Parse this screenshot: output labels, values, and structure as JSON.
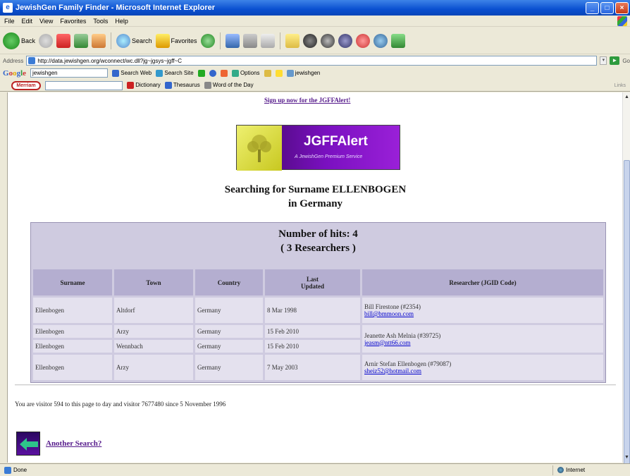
{
  "window": {
    "title": "JewishGen Family Finder - Microsoft Internet Explorer",
    "minimize": "_",
    "maximize": "□",
    "close": "×"
  },
  "menu": [
    "File",
    "Edit",
    "View",
    "Favorites",
    "Tools",
    "Help"
  ],
  "toolbar": {
    "back_label": "Back",
    "search_label": "Search",
    "favorites_label": "Favorites"
  },
  "address": {
    "label": "Address",
    "url": "http://data.jewishgen.org/wconnect/wc.dll?jg~jgsys~jgff~C",
    "go_label": "Go"
  },
  "google_toolbar": {
    "logo": [
      "G",
      "o",
      "o",
      "g",
      "l",
      "e"
    ],
    "query": "jewishgen",
    "search_web": "Search Web",
    "search_site": "Search Site",
    "options": "Options",
    "user": "jewishgen"
  },
  "dict_toolbar": {
    "brand": "Merriam",
    "dictionary": "Dictionary",
    "thesaurus": "Thesaurus",
    "word_of_day": "Word of the Day",
    "links": "Links"
  },
  "page": {
    "signup_link": "Sign up now for the JGFFAlert!",
    "banner_title": "JGFFAlert",
    "banner_subtitle": "A JewishGen Premium Service",
    "heading_line1": "Searching for Surname ELLENBOGEN",
    "heading_line2": "in Germany",
    "hits_line1": "Number of hits: 4",
    "hits_line2": "( 3 Researchers )",
    "columns": [
      "Surname",
      "Town",
      "Country",
      "Last Updated",
      "Researcher (JGID Code)"
    ],
    "rows": [
      {
        "surname": "Ellenbogen",
        "town": "Altdorf",
        "country": "Germany",
        "updated": "8 Mar 1998",
        "researcher": "Bill Firestone (#2354)",
        "email": "bill@bmmoon.com"
      },
      {
        "surname": "Ellenbogen",
        "town": "Arzy",
        "country": "Germany",
        "updated": "15 Feb 2010",
        "researcher": "Jeanette Ash Melnia (#39725)",
        "email": "jeasm@ntt66.com"
      },
      {
        "surname": "Ellenbogen",
        "town": "Wennbach",
        "country": "Germany",
        "updated": "15 Feb 2010"
      },
      {
        "surname": "Ellenbogen",
        "town": "Arzy",
        "country": "Germany",
        "updated": "7 May 2003",
        "researcher": "Arnir Stefan Ellenbogen (#79087)",
        "email": "sheiz52@hotmail.com"
      }
    ],
    "visitor_text": "You are visitor 594 to this page to day and visitor 7677480 since 5 November 1996",
    "another_search": "Another Search?"
  },
  "status": {
    "left": "Done",
    "zone": "Internet"
  }
}
